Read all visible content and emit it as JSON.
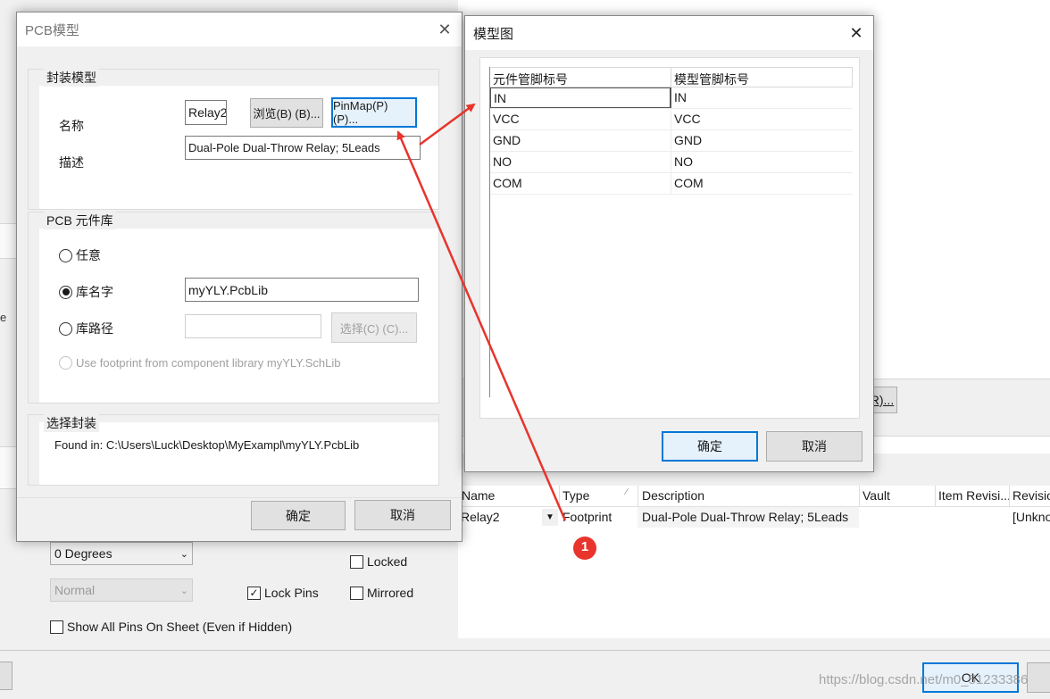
{
  "pcb_dialog": {
    "title": "PCB模型",
    "footprint_group": {
      "label": "封装模型",
      "name_label": "名称",
      "name_value": "Relay2",
      "browse_button": "浏览(B) (B)...",
      "pinmap_button": "PinMap(P) (P)...",
      "desc_label": "描述",
      "desc_value": "Dual-Pole Dual-Throw Relay; 5Leads"
    },
    "library_group": {
      "label": "PCB 元件库",
      "option_any": "任意",
      "option_libname": "库名字",
      "libname_value": "myYLY.PcbLib",
      "option_libpath": "库路径",
      "libpath_value": "",
      "choose_button": "选择(C) (C)...",
      "option_use_footprint": "Use footprint from component library myYLY.SchLib",
      "selected_option": "库名字"
    },
    "selected_group": {
      "label": "选择封装",
      "found_in": "Found in: C:\\Users\\Luck\\Desktop\\MyExampl\\myYLY.PcbLib"
    },
    "ok_button": "确定",
    "cancel_button": "取消"
  },
  "model_dialog": {
    "title": "模型图",
    "columns": [
      "元件管脚标号",
      "模型管脚标号"
    ],
    "rows": [
      {
        "component_pin": "IN",
        "model_pin": "IN"
      },
      {
        "component_pin": "VCC",
        "model_pin": "VCC"
      },
      {
        "component_pin": "GND",
        "model_pin": "GND"
      },
      {
        "component_pin": "NO",
        "model_pin": "NO"
      },
      {
        "component_pin": "COM",
        "model_pin": "COM"
      }
    ],
    "ok_button": "确定",
    "cancel_button": "取消"
  },
  "background": {
    "rotation_select": "0 Degrees",
    "mode_select": "Normal",
    "locked_label": "Locked",
    "lock_pins_label": "Lock Pins",
    "lock_pins_checked": true,
    "mirrored_label": "Mirrored",
    "show_all_pins_label": "Show All Pins On Sheet (Even if Hidden)",
    "partial_button": "R)...",
    "left_edge_char": "e",
    "models_table": {
      "columns": [
        "Name",
        "Type",
        "Description",
        "Vault",
        "Item Revisi...",
        "Revisio"
      ],
      "rows": [
        {
          "name": "Relay2",
          "type": "Footprint",
          "description": "Dual-Pole Dual-Throw Relay; 5Leads",
          "vault": "",
          "item_revision": "",
          "revision": "[Unkno"
        }
      ]
    },
    "ok_button": "OK",
    "watermark": "https://blog.csdn.net/m0_51233386"
  },
  "annotation": {
    "badge": "1",
    "arrow_color": "#e8342c",
    "badge_color": "#e8342c"
  },
  "colors": {
    "accent": "#0078d7",
    "dialog_bg": "#f0f0f0"
  }
}
